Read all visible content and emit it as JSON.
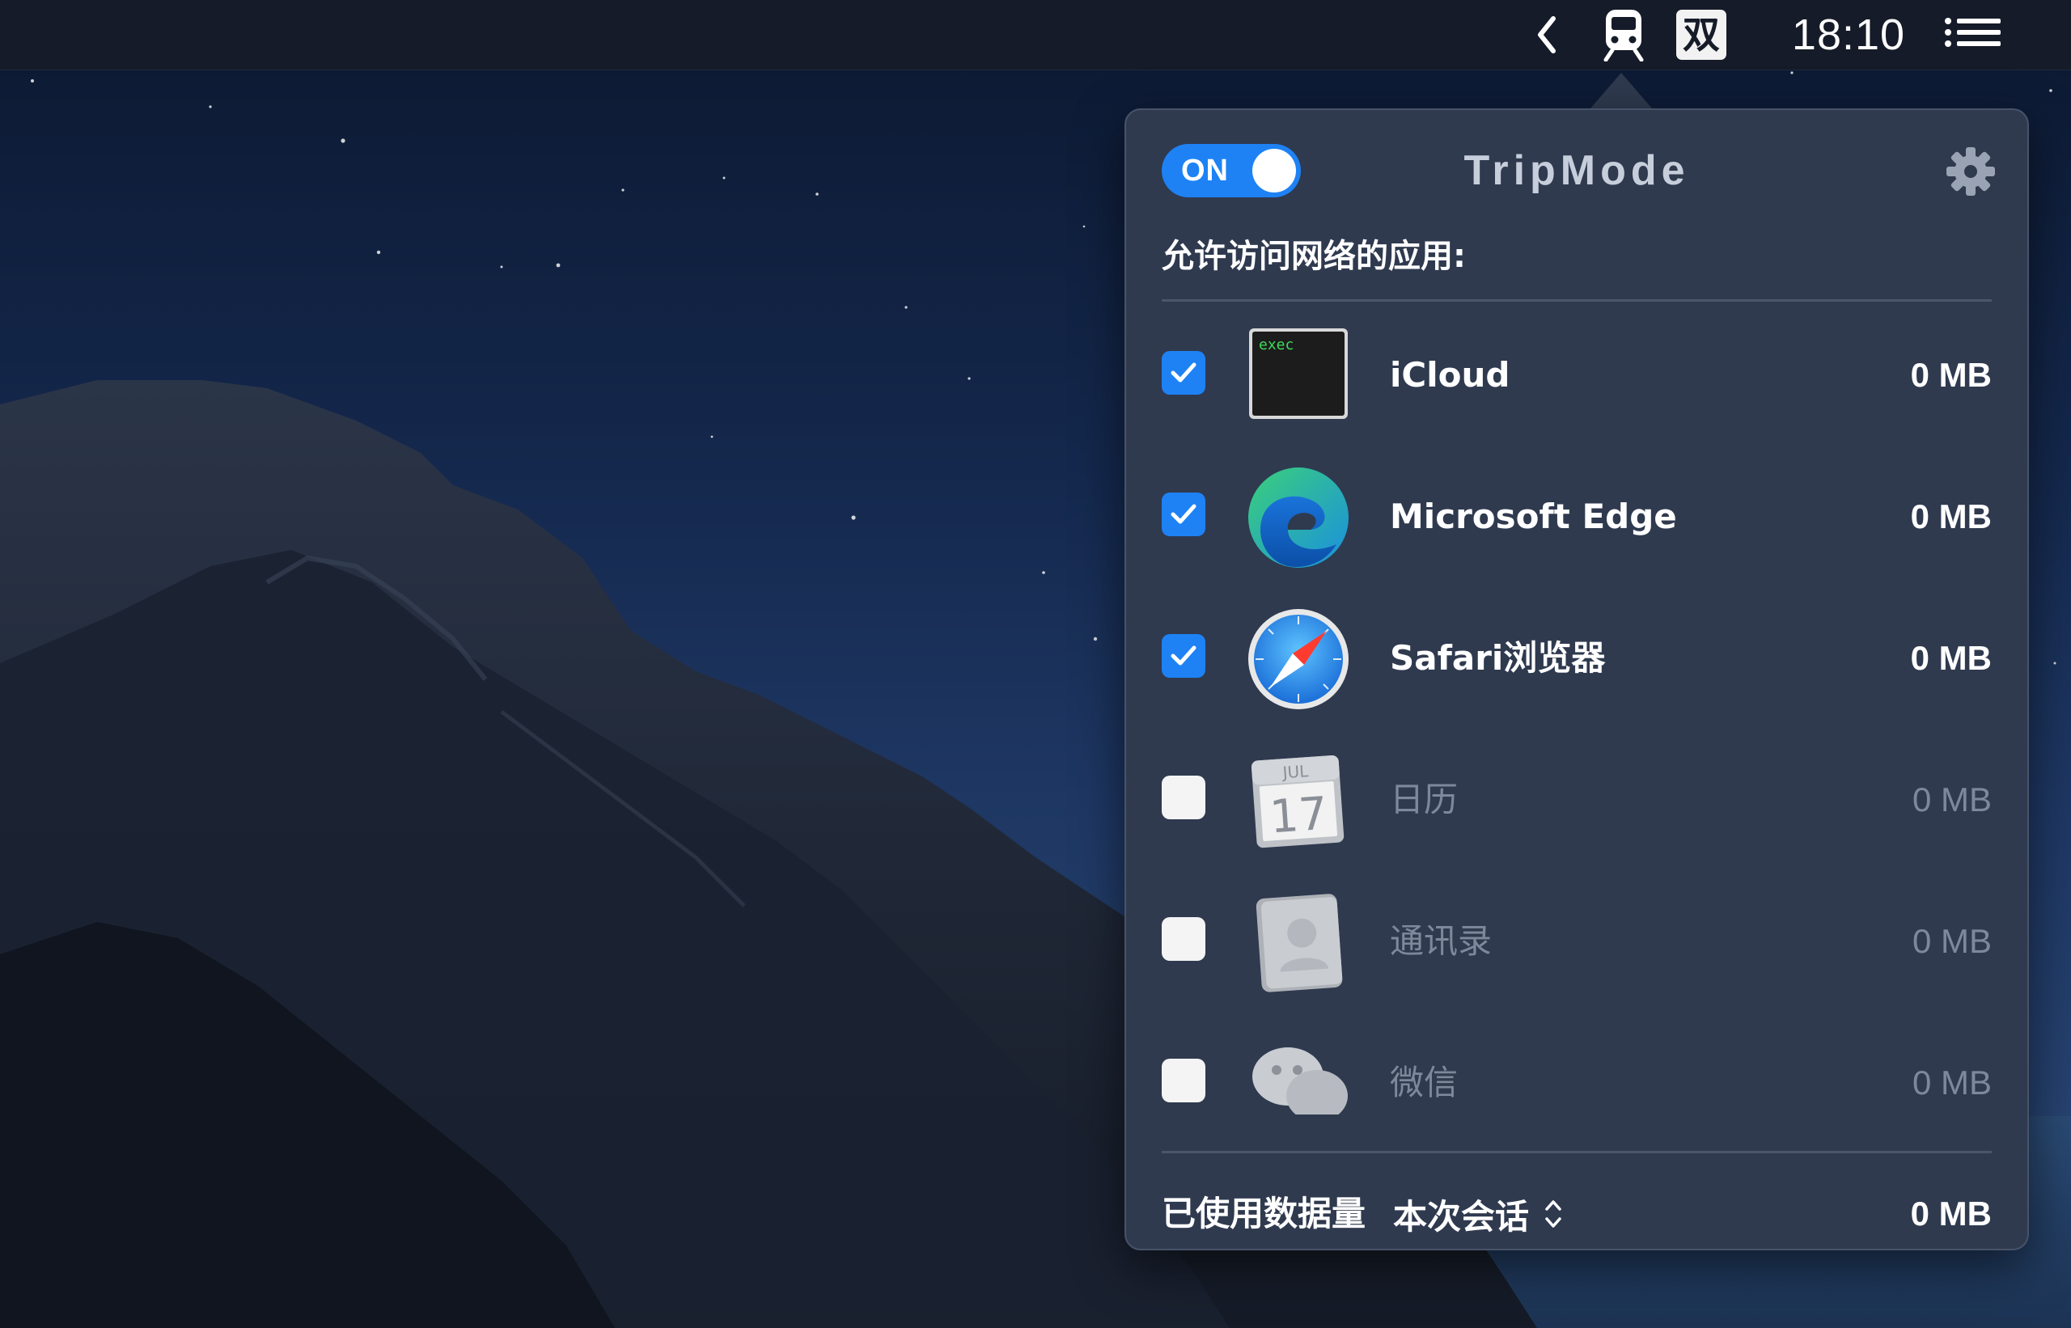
{
  "menubar": {
    "chevron_icon": "chevron-left-icon",
    "tripmode_icon": "train-icon",
    "input_method": "双",
    "clock": "18:10",
    "list_icon": "notification-list-icon"
  },
  "panel": {
    "toggle_label": "ON",
    "toggle_on": true,
    "app_title": "TripMode",
    "settings_icon": "gear-icon",
    "section_title": "允许访问网络的应用:",
    "apps": [
      {
        "name": "iCloud",
        "size": "0 MB",
        "checked": true,
        "icon": "exec-terminal-icon",
        "icon_text": "exec"
      },
      {
        "name": "Microsoft Edge",
        "size": "0 MB",
        "checked": true,
        "icon": "edge-icon"
      },
      {
        "name": "Safari浏览器",
        "size": "0 MB",
        "checked": true,
        "icon": "safari-compass-icon"
      },
      {
        "name": "日历",
        "size": "0 MB",
        "checked": false,
        "icon": "calendar-icon",
        "icon_text_month": "JUL",
        "icon_text_day": "17"
      },
      {
        "name": "通讯录",
        "size": "0 MB",
        "checked": false,
        "icon": "contacts-icon"
      },
      {
        "name": "微信",
        "size": "0 MB",
        "checked": false,
        "icon": "wechat-icon"
      }
    ],
    "footer": {
      "label": "已使用数据量",
      "session": "本次会话",
      "total": "0 MB"
    }
  },
  "colors": {
    "accent": "#1e82f5",
    "panel_bg": "#2f3a4f",
    "menubar_bg": "#161b29"
  }
}
